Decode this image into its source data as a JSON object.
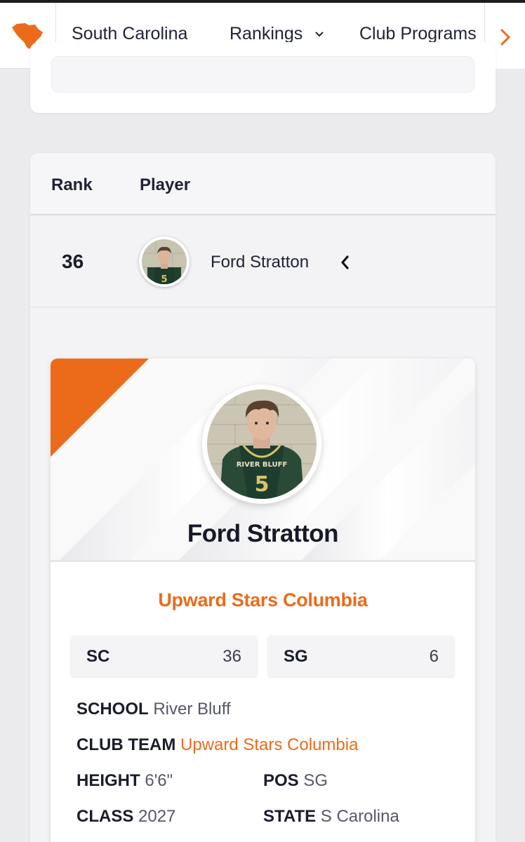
{
  "nav": {
    "state_label": "South Carolina",
    "rankings_label": "Rankings",
    "clubs_label": "Club Programs",
    "logo_icon": "south-carolina-state-icon",
    "next_icon": "chevron-right-icon",
    "accent_color": "#ec6b1a"
  },
  "table": {
    "headers": [
      "Rank",
      "Player"
    ]
  },
  "row": {
    "rank": "36",
    "name": "Ford Stratton",
    "toggle_icon": "chevron-left-icon"
  },
  "player": {
    "name": "Ford Stratton",
    "club": "Upward Stars Columbia",
    "jersey_text": "RIVER BLUFF",
    "jersey_number": "5",
    "stats": [
      {
        "label": "SC",
        "value": "36"
      },
      {
        "label": "SG",
        "value": "6"
      }
    ],
    "info": {
      "school_label": "SCHOOL",
      "school": "River Bluff",
      "club_label": "CLUB TEAM",
      "club": "Upward Stars Columbia",
      "height_label": "HEIGHT",
      "height": "6'6\"",
      "pos_label": "POS",
      "pos": "SG",
      "class_label": "CLASS",
      "class": "2027",
      "state_label": "STATE",
      "state": "S Carolina"
    }
  }
}
